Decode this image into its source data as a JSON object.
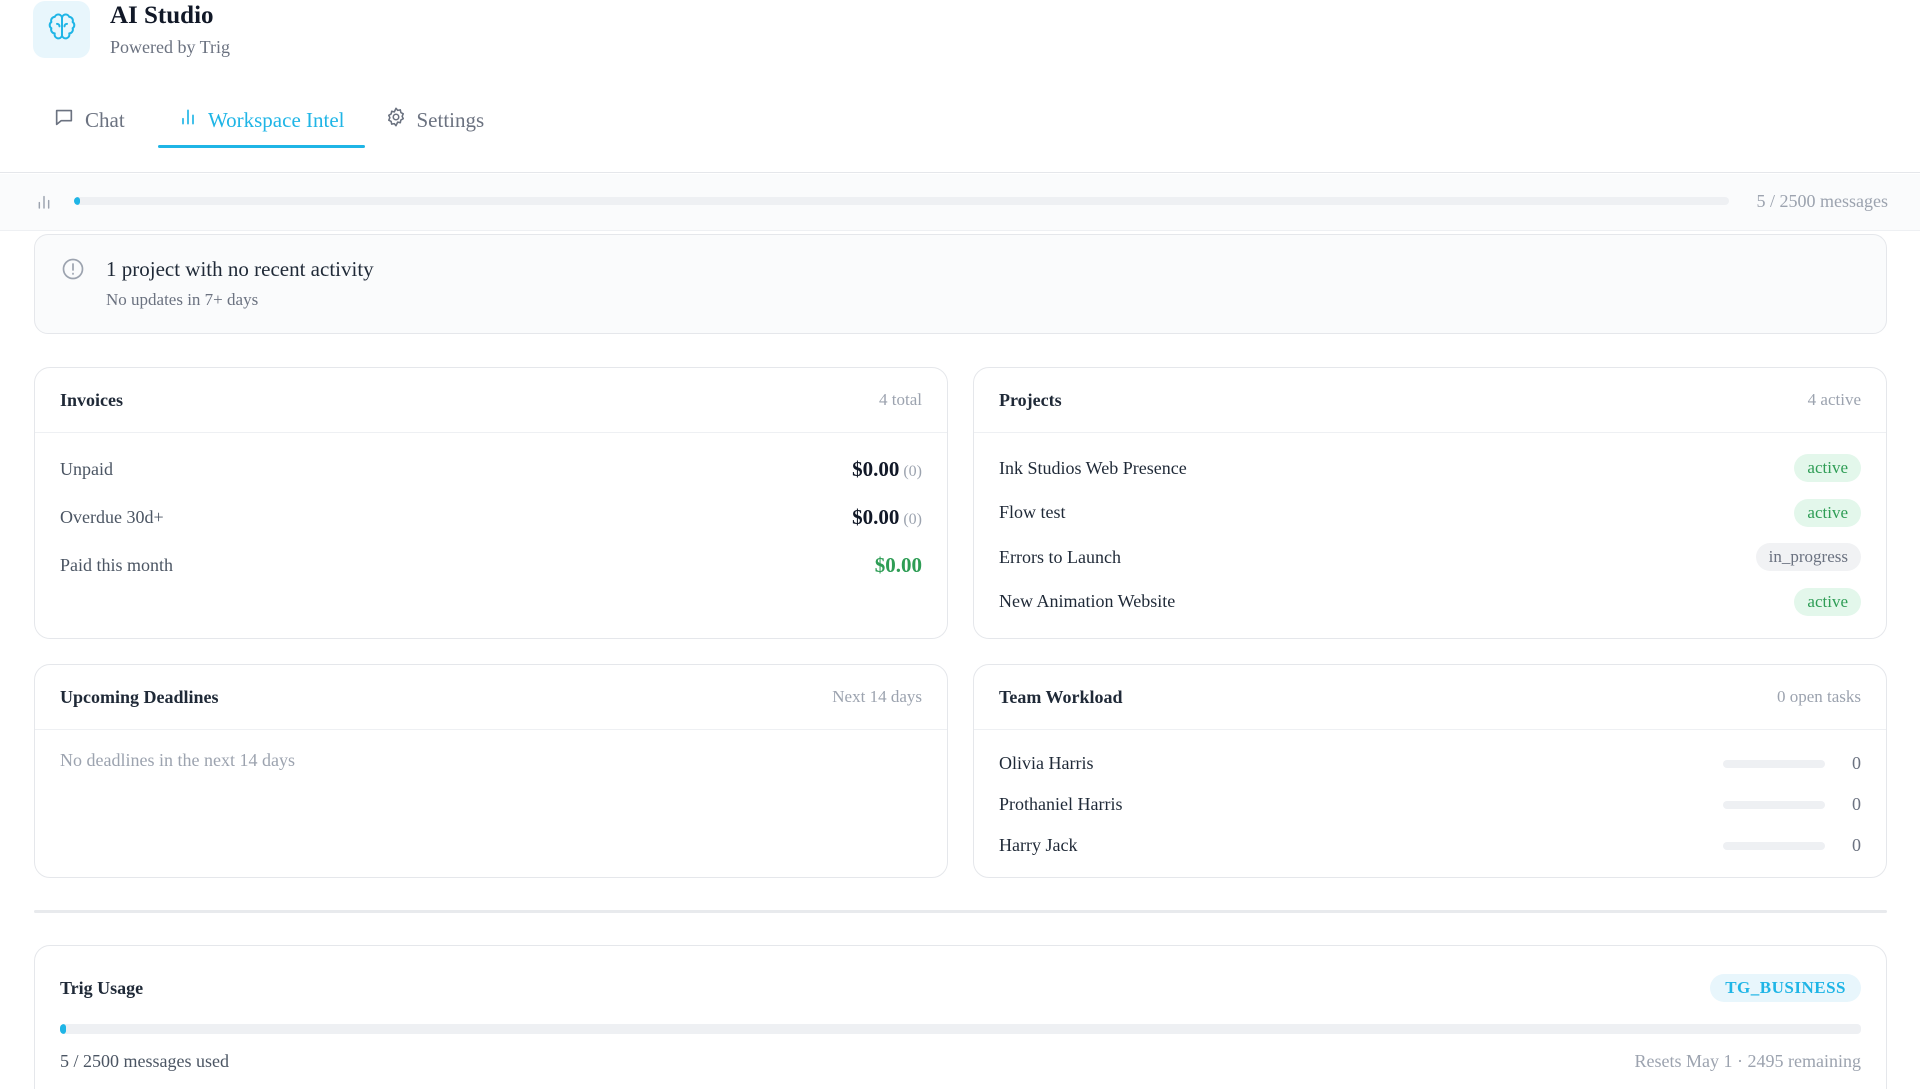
{
  "app": {
    "title": "AI Studio",
    "subtitle": "Powered by Trig",
    "logo_icon": "brain-icon",
    "accent_color": "#1fb5e6"
  },
  "tabs": [
    {
      "label": "Chat",
      "icon": "chat-bubble-icon",
      "active": false
    },
    {
      "label": "Workspace Intel",
      "icon": "bar-chart-icon",
      "active": true
    },
    {
      "label": "Settings",
      "icon": "gear-icon",
      "active": false
    }
  ],
  "usage_strip": {
    "icon": "bar-chart-icon",
    "used": 5,
    "limit": 2500,
    "text": "5 / 2500 messages"
  },
  "alert": {
    "icon": "alert-circle-icon",
    "title": "1 project with no recent activity",
    "subtitle": "No updates in 7+ days"
  },
  "invoices": {
    "title": "Invoices",
    "meta": "4 total",
    "rows": [
      {
        "label": "Unpaid",
        "value": "$0.00",
        "count": "(0)"
      },
      {
        "label": "Overdue 30d+",
        "value": "$0.00",
        "count": "(0)"
      },
      {
        "label": "Paid this month",
        "value": "$0.00",
        "count": ""
      }
    ]
  },
  "projects": {
    "title": "Projects",
    "meta": "4 active",
    "rows": [
      {
        "name": "Ink Studios Web Presence",
        "status": "active"
      },
      {
        "name": "Flow test",
        "status": "active"
      },
      {
        "name": "Errors to Launch",
        "status": "in_progress"
      },
      {
        "name": "New Animation Website",
        "status": "active"
      }
    ]
  },
  "deadlines": {
    "title": "Upcoming Deadlines",
    "meta": "Next 14 days",
    "empty": "No deadlines in the next 14 days"
  },
  "workload": {
    "title": "Team Workload",
    "meta": "0 open tasks",
    "rows": [
      {
        "name": "Olivia Harris",
        "count": "0",
        "level": 0
      },
      {
        "name": "Prothaniel Harris",
        "count": "0",
        "level": 0
      },
      {
        "name": "Harry Jack",
        "count": "0",
        "level": 0
      }
    ]
  },
  "trig_usage": {
    "title": "Trig Usage",
    "plan": "TG_BUSINESS",
    "used": 5,
    "limit": 2500,
    "used_text": "5 / 2500 messages used",
    "reset_text": "Resets May 1 · 2495 remaining"
  }
}
